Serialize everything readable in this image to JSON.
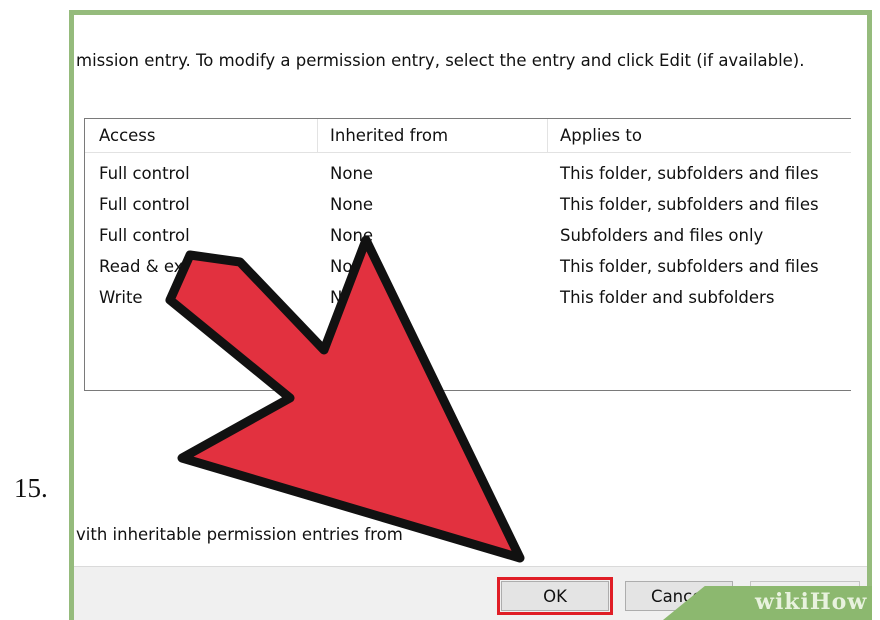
{
  "step": {
    "number": "15."
  },
  "dialog": {
    "instruction": "mission entry. To modify a permission entry, select the entry and click Edit (if available).",
    "columns": [
      "Access",
      "Inherited from",
      "Applies to"
    ],
    "rows": [
      {
        "access": "Full control",
        "inherited_from": "None",
        "applies_to": "This folder, subfolders and files"
      },
      {
        "access": "Full control",
        "inherited_from": "None",
        "applies_to": "This folder, subfolders and files"
      },
      {
        "access": "Full control",
        "inherited_from": "None",
        "applies_to": "Subfolders and files only"
      },
      {
        "access": "Read & execute",
        "inherited_from": "None",
        "applies_to": "This folder, subfolders and files"
      },
      {
        "access": "Write",
        "inherited_from": "None",
        "applies_to": "This folder and subfolders"
      }
    ],
    "footer_text": "vith inheritable permission entries from",
    "buttons": {
      "ok": "OK",
      "cancel": "Cancel",
      "apply": "Apply"
    }
  },
  "watermark": {
    "text": "wikiHow"
  },
  "colors": {
    "frame": "#95bb7c",
    "arrow_fill": "#e2313f",
    "arrow_outline": "#111111",
    "ok_highlight": "#e01e26",
    "watermark_bg": "#8cb86f"
  },
  "icons": {
    "pointer": "red-arrow-icon"
  }
}
